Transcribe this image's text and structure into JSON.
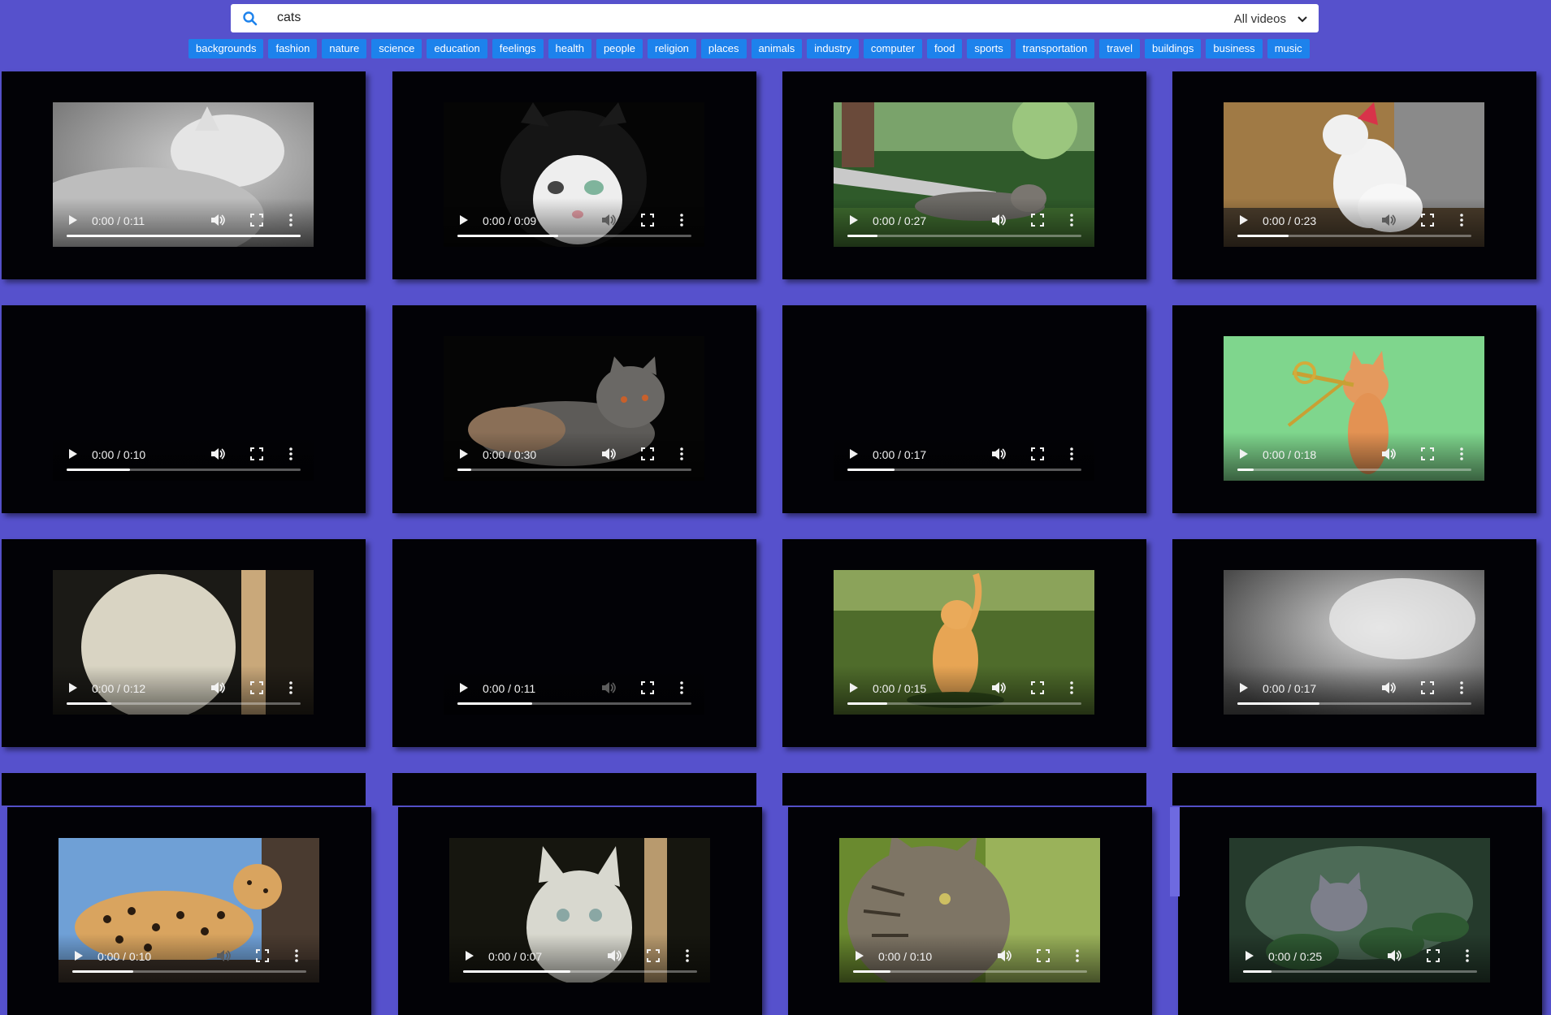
{
  "search": {
    "value": "cats",
    "placeholder": "",
    "filter_label": "All videos"
  },
  "tags": [
    "backgrounds",
    "fashion",
    "nature",
    "science",
    "education",
    "feelings",
    "health",
    "people",
    "religion",
    "places",
    "animals",
    "industry",
    "computer",
    "food",
    "sports",
    "transportation",
    "travel",
    "buildings",
    "business",
    "music"
  ],
  "videos": [
    {
      "time": "0:00 / 0:11",
      "progress": 1.0,
      "volume": "on",
      "thumb": "white-cat-sleeping"
    },
    {
      "time": "0:00 / 0:09",
      "progress": 0.43,
      "volume": "off",
      "thumb": "black-white-cat"
    },
    {
      "time": "0:00 / 0:27",
      "progress": 0.13,
      "volume": "on",
      "thumb": "tabby-on-bench"
    },
    {
      "time": "0:00 / 0:23",
      "progress": 0.22,
      "volume": "off",
      "thumb": "cat-with-bandana"
    },
    {
      "time": "0:00 / 0:10",
      "progress": 0.27,
      "volume": "on",
      "thumb": "black"
    },
    {
      "time": "0:00 / 0:30",
      "progress": 0.06,
      "volume": "on",
      "thumb": "grey-cat-lying"
    },
    {
      "time": "0:00 / 0:17",
      "progress": 0.2,
      "volume": "on",
      "thumb": "black"
    },
    {
      "time": "0:00 / 0:18",
      "progress": 0.07,
      "volume": "on",
      "thumb": "cat-trombone-green"
    },
    {
      "time": "0:00 / 0:12",
      "progress": 0.19,
      "volume": "on",
      "thumb": "white-cat-blurry"
    },
    {
      "time": "0:00 / 0:11",
      "progress": 0.32,
      "volume": "off",
      "thumb": "black"
    },
    {
      "time": "0:00 / 0:15",
      "progress": 0.17,
      "volume": "on",
      "thumb": "orange-cat-grass"
    },
    {
      "time": "0:00 / 0:17",
      "progress": 0.35,
      "volume": "on",
      "thumb": "white-fur-closeup"
    },
    {
      "time": "0:00 / 0:10",
      "progress": 0.26,
      "volume": "off",
      "thumb": "leopard"
    },
    {
      "time": "0:00 / 0:07",
      "progress": 0.46,
      "volume": "on",
      "thumb": "white-cat-face"
    },
    {
      "time": "0:00 / 0:10",
      "progress": 0.16,
      "volume": "on",
      "thumb": "tabby-closeup"
    },
    {
      "time": "0:00 / 0:25",
      "progress": 0.12,
      "volume": "on",
      "thumb": "kitten-in-plants"
    }
  ]
}
